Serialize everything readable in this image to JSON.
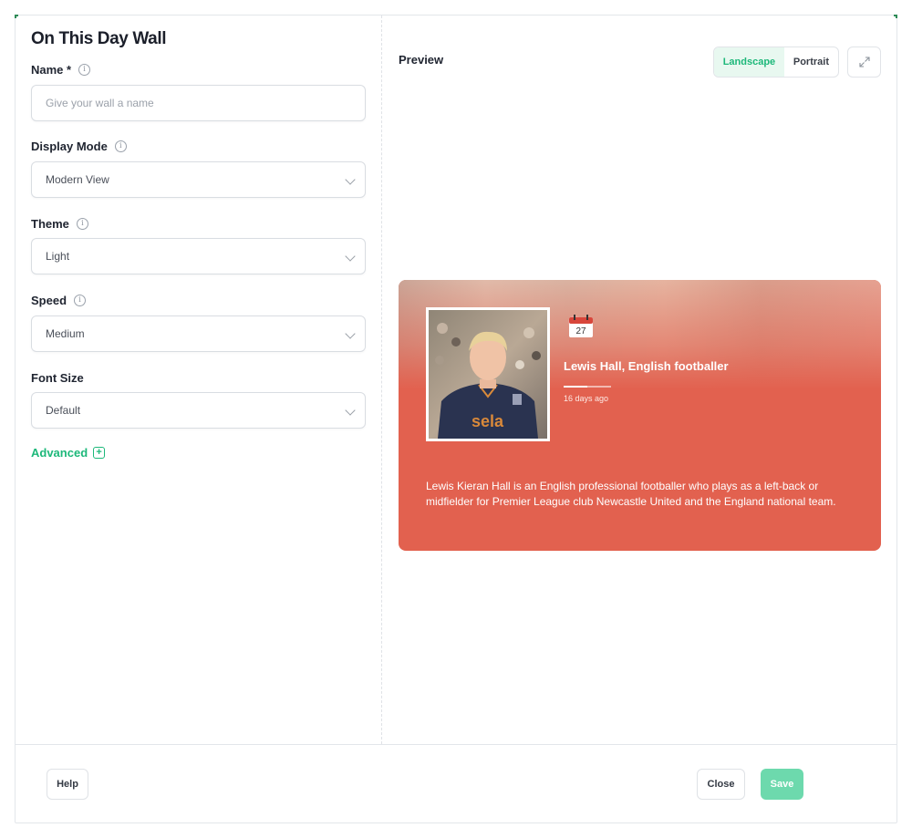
{
  "form": {
    "title": "On This Day Wall",
    "name": {
      "label": "Name *",
      "placeholder": "Give your wall a name",
      "value": ""
    },
    "display_mode": {
      "label": "Display Mode",
      "value": "Modern View"
    },
    "theme": {
      "label": "Theme",
      "value": "Light"
    },
    "speed": {
      "label": "Speed",
      "value": "Medium"
    },
    "font_size": {
      "label": "Font Size",
      "value": "Default"
    },
    "advanced_label": "Advanced"
  },
  "preview": {
    "label": "Preview",
    "orientation": {
      "landscape": "Landscape",
      "portrait": "Portrait",
      "selected": "Landscape"
    },
    "card": {
      "calendar_day": "27",
      "title": "Lewis Hall, English footballer",
      "time_ago": "16 days ago",
      "description": "Lewis Kieran Hall is an English professional footballer who plays as a left-back or midfielder for Premier League club Newcastle United and the England national team.",
      "photo_sponsor_text": "sela",
      "bg_color": "#e2614f"
    }
  },
  "footer": {
    "help_label": "Help",
    "close_label": "Close",
    "save_label": "Save"
  },
  "colors": {
    "accent": "#1db87a",
    "save_button": "#6dd9ad"
  }
}
